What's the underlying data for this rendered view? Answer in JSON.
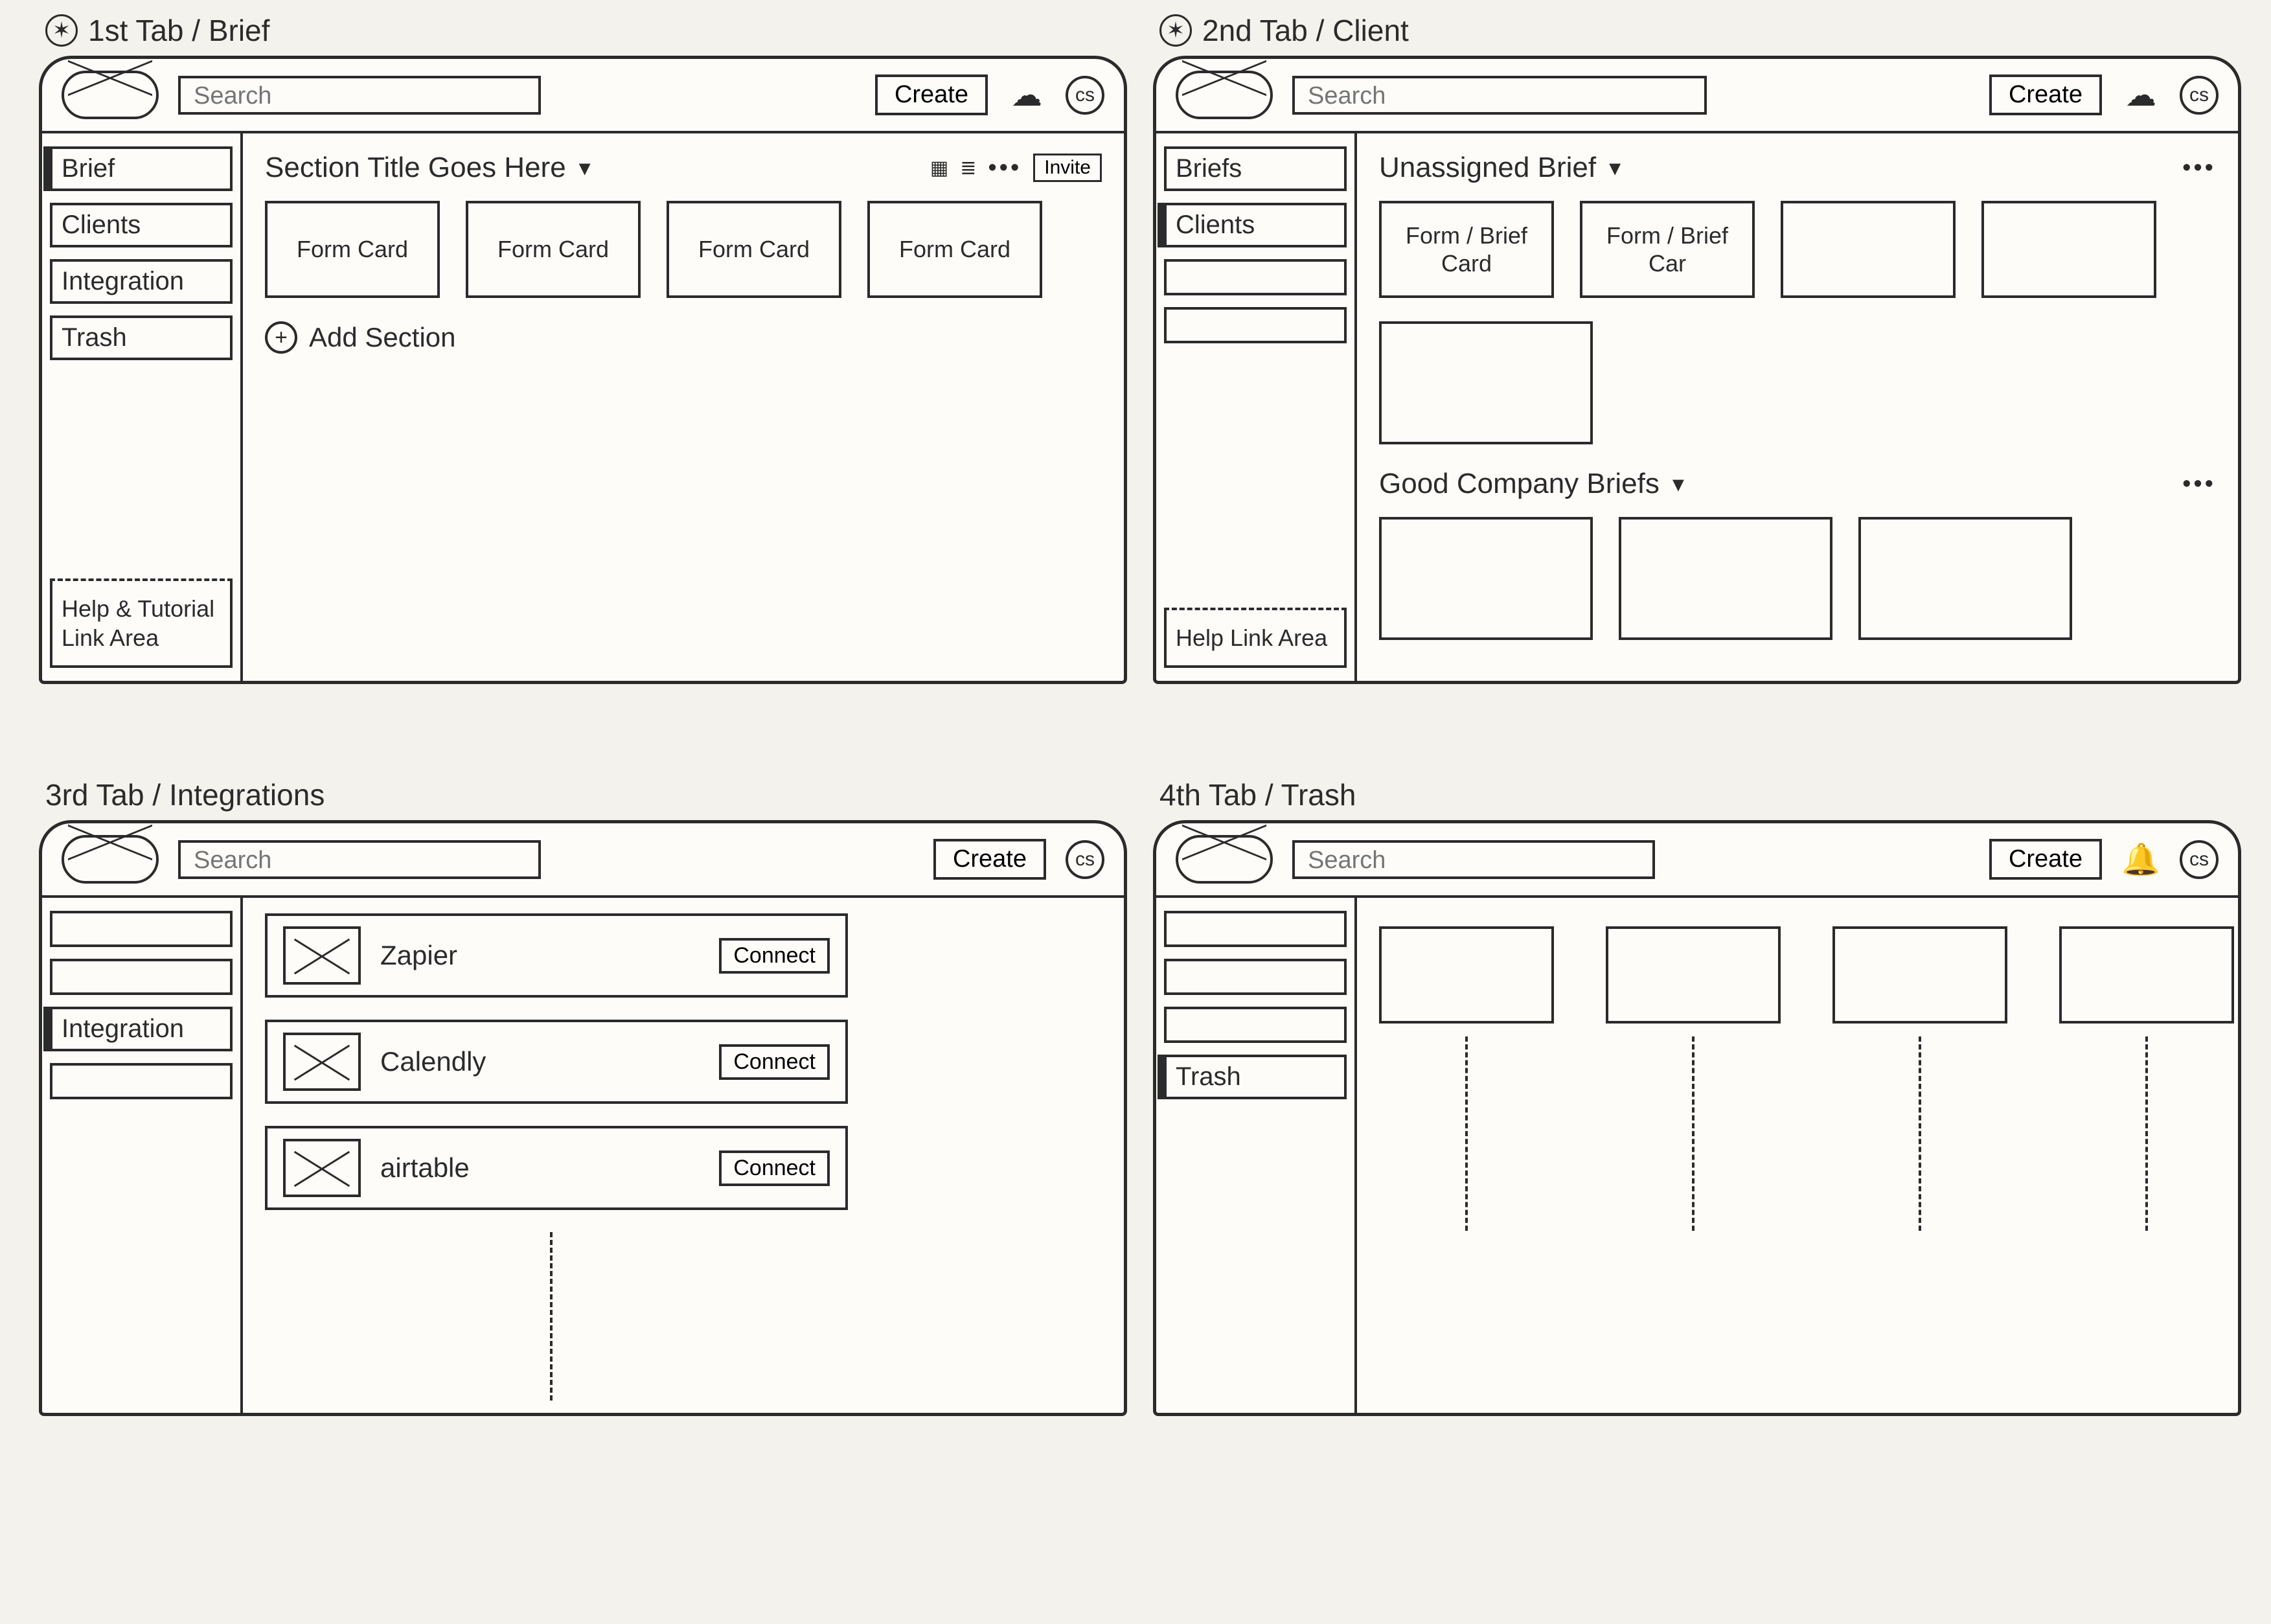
{
  "screens": {
    "brief": {
      "annotation": "1st Tab / Brief",
      "search_placeholder": "Search",
      "create_label": "Create",
      "avatar_initials": "cs",
      "sidebar": {
        "items": [
          {
            "label": "Brief",
            "active": true
          },
          {
            "label": "Clients",
            "active": false
          },
          {
            "label": "Integration",
            "active": false
          },
          {
            "label": "Trash",
            "active": false
          }
        ],
        "help_text": "Help & Tutorial Link Area"
      },
      "section_title": "Section Title Goes Here",
      "invite_label": "Invite",
      "cards": [
        {
          "label": "Form Card"
        },
        {
          "label": "Form Card"
        },
        {
          "label": "Form Card"
        },
        {
          "label": "Form Card"
        }
      ],
      "add_section_label": "Add Section"
    },
    "client": {
      "annotation": "2nd Tab / Client",
      "search_placeholder": "Search",
      "create_label": "Create",
      "avatar_initials": "cs",
      "sidebar": {
        "items": [
          {
            "label": "Briefs",
            "active": false
          },
          {
            "label": "Clients",
            "active": true
          },
          {
            "label": "",
            "active": false
          },
          {
            "label": "",
            "active": false
          }
        ],
        "help_text": "Help Link Area"
      },
      "groups": [
        {
          "title": "Unassigned Brief",
          "cards": [
            {
              "label": "Form / Brief Card"
            },
            {
              "label": "Form / Brief Car"
            },
            {
              "label": ""
            },
            {
              "label": ""
            },
            {
              "label": ""
            }
          ]
        },
        {
          "title": "Good Company Briefs",
          "cards": [
            {
              "label": ""
            },
            {
              "label": ""
            },
            {
              "label": ""
            }
          ]
        }
      ]
    },
    "integrations": {
      "annotation": "3rd Tab / Integrations",
      "search_placeholder": "Search",
      "create_label": "Create",
      "avatar_initials": "cs",
      "sidebar": {
        "items": [
          {
            "label": "",
            "active": false
          },
          {
            "label": "",
            "active": false
          },
          {
            "label": "Integration",
            "active": true
          },
          {
            "label": "",
            "active": false
          }
        ]
      },
      "connect_label": "Connect",
      "rows": [
        {
          "name": "Zapier"
        },
        {
          "name": "Calendly"
        },
        {
          "name": "airtable"
        }
      ]
    },
    "trash": {
      "annotation": "4th Tab / Trash",
      "search_placeholder": "Search",
      "create_label": "Create",
      "avatar_initials": "cs",
      "sidebar": {
        "items": [
          {
            "label": "",
            "active": false
          },
          {
            "label": "",
            "active": false
          },
          {
            "label": "",
            "active": false
          },
          {
            "label": "Trash",
            "active": true
          }
        ]
      },
      "card_count": 4
    }
  }
}
